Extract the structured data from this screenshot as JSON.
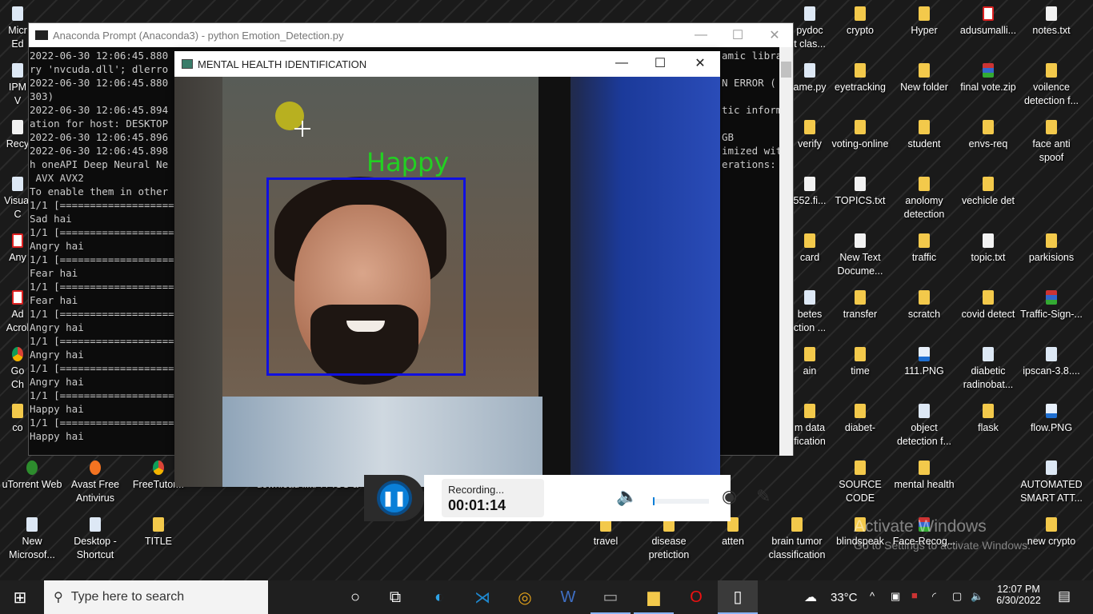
{
  "desktop": {
    "icons": [
      {
        "label": "pydoc\nt clas...",
        "icon": "python-file-icon",
        "kind": "doc"
      },
      {
        "label": "crypto",
        "icon": "folder-icon",
        "kind": "folder"
      },
      {
        "label": "Hyper",
        "icon": "folder-icon",
        "kind": "folder"
      },
      {
        "label": "adusumalli...",
        "icon": "pdf-icon",
        "kind": "pdf"
      },
      {
        "label": "notes.txt",
        "icon": "text-file-icon",
        "kind": "file"
      },
      {
        "label": "ame.py",
        "icon": "python-file-icon",
        "kind": "doc"
      },
      {
        "label": "eyetracking",
        "icon": "folder-icon",
        "kind": "folder"
      },
      {
        "label": "New folder",
        "icon": "folder-icon",
        "kind": "folder"
      },
      {
        "label": "final vote.zip",
        "icon": "winrar-icon",
        "kind": "zip"
      },
      {
        "label": "voilence\ndetection f...",
        "icon": "folder-icon",
        "kind": "folder"
      },
      {
        "label": "verify",
        "icon": "folder-icon",
        "kind": "folder"
      },
      {
        "label": "voting-online",
        "icon": "folder-icon",
        "kind": "folder"
      },
      {
        "label": "student",
        "icon": "folder-icon",
        "kind": "folder"
      },
      {
        "label": "envs-req",
        "icon": "folder-icon",
        "kind": "folder"
      },
      {
        "label": "face anti\nspoof",
        "icon": "folder-icon",
        "kind": "folder"
      },
      {
        "label": "552.fi...",
        "icon": "text-file-icon",
        "kind": "file"
      },
      {
        "label": "TOPICS.txt",
        "icon": "text-file-icon",
        "kind": "file"
      },
      {
        "label": "anolomy\ndetection",
        "icon": "folder-icon",
        "kind": "folder"
      },
      {
        "label": "vechicle det",
        "icon": "folder-icon",
        "kind": "folder"
      },
      {
        "label": "card",
        "icon": "folder-icon",
        "kind": "folder"
      },
      {
        "label": "New Text\nDocume...",
        "icon": "text-file-icon",
        "kind": "file"
      },
      {
        "label": "traffic",
        "icon": "folder-icon",
        "kind": "folder"
      },
      {
        "label": "topic.txt",
        "icon": "text-file-icon",
        "kind": "file"
      },
      {
        "label": "parkisions",
        "icon": "folder-icon",
        "kind": "folder"
      },
      {
        "label": "betes\nction ...",
        "icon": "document-icon",
        "kind": "doc"
      },
      {
        "label": "transfer",
        "icon": "folder-icon",
        "kind": "folder"
      },
      {
        "label": "scratch",
        "icon": "folder-icon",
        "kind": "folder"
      },
      {
        "label": "covid detect",
        "icon": "folder-icon",
        "kind": "folder"
      },
      {
        "label": "Traffic-Sign-...",
        "icon": "winrar-icon",
        "kind": "zip"
      },
      {
        "label": "ain",
        "icon": "folder-icon",
        "kind": "folder"
      },
      {
        "label": "time",
        "icon": "folder-icon",
        "kind": "folder"
      },
      {
        "label": "111.PNG",
        "icon": "image-file-icon",
        "kind": "img"
      },
      {
        "label": "diabetic\nradinobat...",
        "icon": "document-icon",
        "kind": "doc"
      },
      {
        "label": "ipscan-3.8....",
        "icon": "installer-icon",
        "kind": "doc"
      },
      {
        "label": "m data\nfication",
        "icon": "folder-icon",
        "kind": "folder"
      },
      {
        "label": "diabet-",
        "icon": "folder-icon",
        "kind": "folder"
      },
      {
        "label": "object\ndetection f...",
        "icon": "document-icon",
        "kind": "doc"
      },
      {
        "label": "flask",
        "icon": "folder-icon",
        "kind": "folder"
      },
      {
        "label": "flow.PNG",
        "icon": "image-file-icon",
        "kind": "img"
      },
      {
        "label": "SOURCE\nCODE",
        "icon": "folder-icon",
        "kind": "folder"
      },
      {
        "label": "mental health",
        "icon": "folder-icon",
        "kind": "folder"
      },
      {
        "label": "AUTOMATED\nSMART ATT...",
        "icon": "document-icon",
        "kind": "doc"
      },
      {
        "label": "brain tumor\nclassification",
        "icon": "folder-icon",
        "kind": "folder"
      },
      {
        "label": "blindspeak",
        "icon": "folder-icon",
        "kind": "folder"
      },
      {
        "label": "Face-Recog...",
        "icon": "winrar-icon",
        "kind": "zip"
      },
      {
        "label": "new crypto",
        "icon": "folder-icon",
        "kind": "folder"
      },
      {
        "label": "travel",
        "icon": "folder-icon",
        "kind": "folder"
      },
      {
        "label": "disease\npretiction",
        "icon": "folder-icon",
        "kind": "folder"
      },
      {
        "label": "atten",
        "icon": "folder-icon",
        "kind": "folder"
      },
      {
        "label": "uTorrent Web",
        "icon": "utorrent-icon",
        "kind": "app"
      },
      {
        "label": "Avast Free\nAntivirus",
        "icon": "avast-icon",
        "kind": "avast"
      },
      {
        "label": "FreeTutor...",
        "icon": "chrome-icon",
        "kind": "chrome"
      },
      {
        "label": "download li...",
        "icon": "file-icon",
        "kind": "file"
      },
      {
        "label": "Pi PICO a",
        "icon": "file-icon",
        "kind": "file"
      },
      {
        "label": "New\nMicrosof...",
        "icon": "document-icon",
        "kind": "doc"
      },
      {
        "label": "Desktop -\nShortcut",
        "icon": "shortcut-icon",
        "kind": "doc"
      },
      {
        "label": "TITLE",
        "icon": "folder-icon",
        "kind": "folder"
      },
      {
        "label": "Micr\nEd",
        "icon": "edge-icon",
        "kind": "doc"
      },
      {
        "label": "IPM\nV",
        "icon": "app-icon",
        "kind": "doc"
      },
      {
        "label": "Recy",
        "icon": "recycle-bin-icon",
        "kind": "file"
      },
      {
        "label": "Visual\nC",
        "icon": "vscode-icon",
        "kind": "doc"
      },
      {
        "label": "Any",
        "icon": "anydesk-icon",
        "kind": "pdf"
      },
      {
        "label": "Ad\nAcrol",
        "icon": "acrobat-icon",
        "kind": "pdf"
      },
      {
        "label": "Go\nCh",
        "icon": "chrome-icon",
        "kind": "chrome"
      },
      {
        "label": "co",
        "icon": "folder-icon",
        "kind": "folder"
      }
    ],
    "watermark_title": "Activate Windows",
    "watermark_sub": "Go to Settings to activate Windows."
  },
  "console": {
    "title": "Anaconda Prompt (Anaconda3) - python  Emotion_Detection.py",
    "lines": [
      {
        "l": "2022-06-30 12:06:45.880",
        "r": "amic libra"
      },
      {
        "l": "ry 'nvcuda.dll'; dlerro",
        "r": ""
      },
      {
        "l": "2022-06-30 12:06:45.880",
        "r": "N ERROR ("
      },
      {
        "l": "303)",
        "r": ""
      },
      {
        "l": "2022-06-30 12:06:45.894",
        "r": "tic inform"
      },
      {
        "l": "ation for host: DESKTOP",
        "r": ""
      },
      {
        "l": "2022-06-30 12:06:45.896",
        "r": "GB"
      },
      {
        "l": "2022-06-30 12:06:45.898",
        "r": "imized wit"
      },
      {
        "l": "h oneAPI Deep Neural Ne",
        "r": "erations:"
      },
      {
        "l": " AVX AVX2",
        "r": ""
      },
      {
        "l": "To enable them in other",
        "r": ""
      },
      {
        "l": "1/1 [===================",
        "r": ""
      },
      {
        "l": "Sad hai",
        "r": ""
      },
      {
        "l": "1/1 [===================",
        "r": ""
      },
      {
        "l": "Angry hai",
        "r": ""
      },
      {
        "l": "1/1 [===================",
        "r": ""
      },
      {
        "l": "Fear hai",
        "r": ""
      },
      {
        "l": "1/1 [===================",
        "r": ""
      },
      {
        "l": "Fear hai",
        "r": ""
      },
      {
        "l": "1/1 [===================",
        "r": ""
      },
      {
        "l": "Angry hai",
        "r": ""
      },
      {
        "l": "1/1 [===================",
        "r": ""
      },
      {
        "l": "Angry hai",
        "r": ""
      },
      {
        "l": "1/1 [===================",
        "r": ""
      },
      {
        "l": "Angry hai",
        "r": ""
      },
      {
        "l": "1/1 [===================",
        "r": ""
      },
      {
        "l": "Happy hai",
        "r": ""
      },
      {
        "l": "1/1 [===================",
        "r": ""
      },
      {
        "l": "Happy hai",
        "r": ""
      }
    ]
  },
  "detector": {
    "title": "MENTAL HEALTH IDENTIFICATION",
    "emotion_label": "Happy",
    "box_color": "#1010e0",
    "label_color": "#22d022"
  },
  "recorder": {
    "status": "Recording...",
    "elapsed": "00:01:14",
    "pause_icon": "pause-icon",
    "mic_level": 0.02
  },
  "taskbar": {
    "search_placeholder": "Type here to search",
    "apps": [
      "cortana",
      "task-view",
      "edge",
      "vscode",
      "chrome",
      "word",
      "terminal",
      "file-explorer",
      "opera",
      "notepad"
    ],
    "temperature": "33°C",
    "time": "12:07 PM",
    "date": "6/30/2022"
  }
}
